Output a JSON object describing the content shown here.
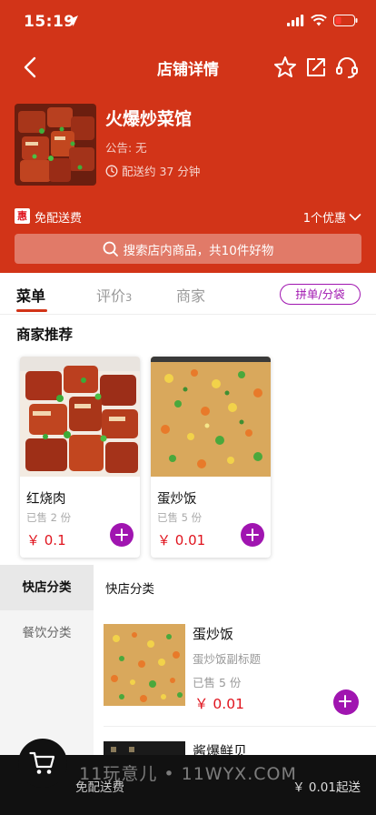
{
  "status": {
    "time": "15:19"
  },
  "nav": {
    "title": "店铺详情"
  },
  "store": {
    "name": "火爆炒菜馆",
    "notice": "公告: 无",
    "delivery": "配送约 37 分钟"
  },
  "promo": {
    "badge": "惠",
    "text": "免配送费",
    "offers": "1个优惠"
  },
  "search": {
    "placeholder": "搜索店内商品，共10件好物"
  },
  "tabs": [
    {
      "label": "菜单"
    },
    {
      "label": "评价",
      "count": "3"
    },
    {
      "label": "商家"
    }
  ],
  "group_button": "拼单/分袋",
  "recommend": {
    "title": "商家推荐",
    "items": [
      {
        "name": "红烧肉",
        "sold": "已售 2 份",
        "price": "￥ 0.1"
      },
      {
        "name": "蛋炒饭",
        "sold": "已售 5 份",
        "price": "￥ 0.01"
      }
    ]
  },
  "categories": [
    {
      "label": "快店分类"
    },
    {
      "label": "餐饮分类"
    }
  ],
  "category_title": "快店分类",
  "menu_items": [
    {
      "name": "蛋炒饭",
      "subtitle": "蛋炒饭副标题",
      "sold": "已售 5 份",
      "price": "￥ 0.01"
    },
    {
      "name": "酱爆鲜贝"
    }
  ],
  "bottom": {
    "free_delivery": "免配送费",
    "min_order": "￥ 0.01起送"
  },
  "watermark": "11玩意儿 • 11WYX.COM",
  "colors": {
    "primary": "#d23418",
    "accent": "#a015b0",
    "price": "#e0141e"
  }
}
